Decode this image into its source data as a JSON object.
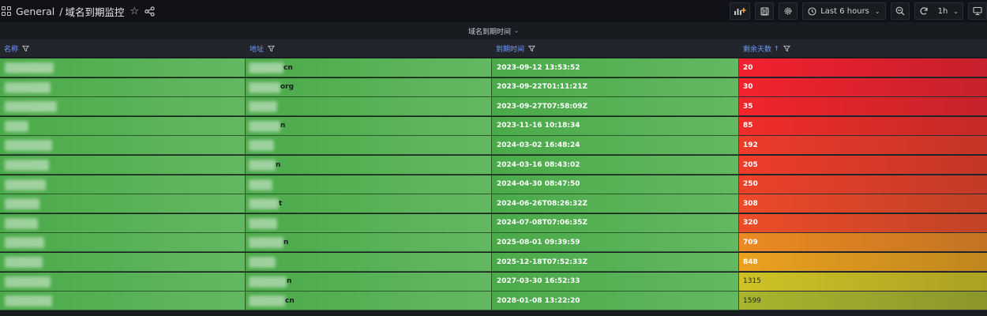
{
  "navbar": {
    "folder": "General",
    "separator": "/",
    "dashboard_title": "域名到期监控",
    "time_range": "Last 6 hours",
    "refresh_interval": "1h"
  },
  "panel": {
    "title": "域名到期时间"
  },
  "table": {
    "columns": {
      "name": "名称",
      "address": "地址",
      "expiry": "到期时间",
      "days_left": "剩余天数"
    },
    "rows": [
      {
        "address_suffix": "cn",
        "expiry": "2023-09-12 13:53:52",
        "days": "20",
        "days_color": "#f2212f",
        "days_text_color": "#ffffff"
      },
      {
        "address_suffix": "org",
        "expiry": "2023-09-22T01:11:21Z",
        "days": "30",
        "days_color": "#f2232e",
        "days_text_color": "#ffffff"
      },
      {
        "address_suffix": "",
        "expiry": "2023-09-27T07:58:09Z",
        "days": "35",
        "days_color": "#f1252c",
        "days_text_color": "#ffffff"
      },
      {
        "address_suffix": "n",
        "expiry": "2023-11-16 10:18:34",
        "days": "85",
        "days_color": "#f02d2a",
        "days_text_color": "#ffffff"
      },
      {
        "address_suffix": "",
        "expiry": "2024-03-02 16:48:24",
        "days": "192",
        "days_color": "#ee3b2a",
        "days_text_color": "#ffffff"
      },
      {
        "address_suffix": "n",
        "expiry": "2024-03-16 08:43:02",
        "days": "205",
        "days_color": "#ee3d29",
        "days_text_color": "#ffffff"
      },
      {
        "address_suffix": "",
        "expiry": "2024-04-30 08:47:50",
        "days": "250",
        "days_color": "#ed4229",
        "days_text_color": "#ffffff"
      },
      {
        "address_suffix": "t",
        "expiry": "2024-06-26T08:26:32Z",
        "days": "308",
        "days_color": "#ec4a28",
        "days_text_color": "#ffffff"
      },
      {
        "address_suffix": "",
        "expiry": "2024-07-08T07:06:35Z",
        "days": "320",
        "days_color": "#ec4d28",
        "days_text_color": "#ffffff"
      },
      {
        "address_suffix": "n",
        "expiry": "2025-08-01 09:39:59",
        "days": "709",
        "days_color": "#ec8a22",
        "days_text_color": "#ffffff"
      },
      {
        "address_suffix": "",
        "expiry": "2025-12-18T07:52:33Z",
        "days": "848",
        "days_color": "#eaa11e",
        "days_text_color": "#ffffff"
      },
      {
        "address_suffix": "n",
        "expiry": "2027-03-30 16:52:33",
        "days": "1315",
        "days_color": "#cfc225",
        "days_text_color": "#1f2220"
      },
      {
        "address_suffix": "cn",
        "expiry": "2028-01-08 13:22:20",
        "days": "1599",
        "days_color": "#a8b52d",
        "days_text_color": "#1f2220"
      }
    ]
  }
}
